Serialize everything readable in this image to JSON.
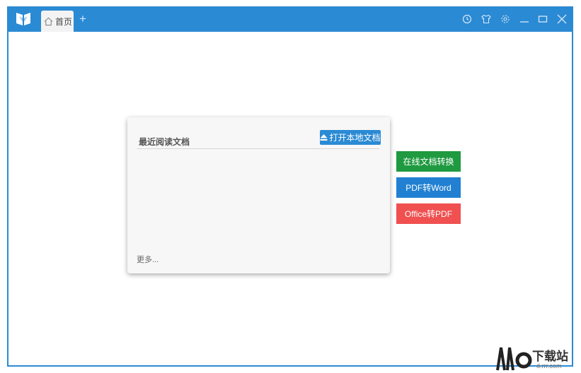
{
  "tabs": [
    {
      "label": "首页"
    }
  ],
  "add_tab_label": "+",
  "window_controls": [
    "history-icon",
    "skin-icon",
    "settings-icon",
    "minimize-icon",
    "maximize-icon",
    "close-icon"
  ],
  "recent": {
    "title": "最近阅读文档",
    "open_local_label": "打开本地文档",
    "more_label": "更多..."
  },
  "actions": {
    "online_convert": "在线文档转换",
    "pdf_to_word": "PDF转Word",
    "office_to_pdf": "Office转PDF"
  },
  "watermark": {
    "text": "下载站",
    "sub": "d.rrr.com"
  },
  "colors": {
    "accent": "#2b8ad4",
    "green": "#1f9a40",
    "blue": "#2180d2",
    "red": "#f05050"
  }
}
